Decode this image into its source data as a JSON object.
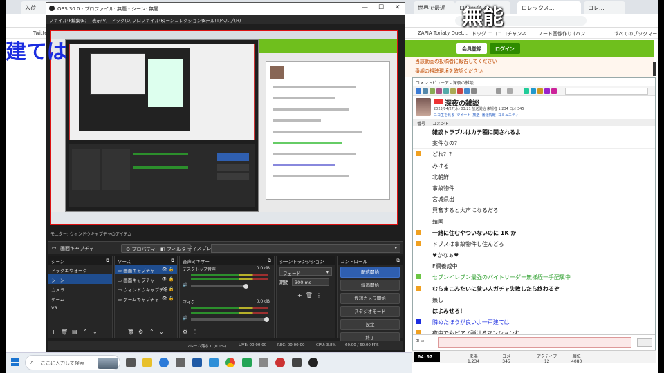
{
  "browser": {
    "tabs": [
      "入荷",
      "世界で最近",
      "ロレックス...",
      "ロレックス...",
      "ロレ..."
    ],
    "bookmarks": [
      "Twitter",
      "ZAPIA Toriaty Duet...",
      "ドッグ ニコニコチャンネ...",
      "ノード画像作り (ハン...",
      "すべてのブックマーク"
    ],
    "mu_overlay": "無能",
    "blue_overlay": "建ては",
    "nico_bar": {
      "btn_member": "会員登録",
      "btn_login": "ログイン"
    },
    "nico_lines": [
      "当該動画の投稿者に報告してください",
      "番組の視聴環境を確認ください"
    ]
  },
  "obs": {
    "title": "OBS 30.0 - プロファイル: 無題 - シーン: 無題",
    "menu": [
      "ファイル(F)",
      "編集(E)",
      "表示(V)",
      "ドック(D)",
      "プロファイル(P)",
      "シーンコレクション(S)",
      "ツール(T)",
      "ヘルプ(H)"
    ],
    "dock_label": "モニター: ウィンドウキャプチャのアイテム",
    "source_bar": {
      "selected": "画面キャプチャ",
      "properties": "プロパティ",
      "filters": "フィルタ",
      "display_label": "ディスプレイ"
    },
    "scenes_title": "シーン",
    "scenes": [
      "ドラクエウォーク",
      "シーン",
      "カメラ",
      "ゲーム",
      "VR"
    ],
    "sources_title": "ソース",
    "sources": [
      "画面キャプチャ",
      "画面キャプチャ",
      "ウィンドウキャプチャ",
      "ゲームキャプチャ"
    ],
    "mixer_title": "音声ミキサー",
    "mixer": [
      {
        "name": "デスクトップ音声",
        "db": "0.0 dB"
      },
      {
        "name": "マイク",
        "db": "0.0 dB"
      }
    ],
    "transitions_title": "シーントランジション",
    "transition_value": "フェード",
    "duration_label": "期間",
    "duration_value": "300 ms",
    "controls_title": "コントロール",
    "controls": [
      "配信開始",
      "録画開始",
      "仮想カメラ開始",
      "スタジオモード",
      "設定",
      "終了"
    ],
    "status": [
      "フレーム落ち 0 (0.0%)",
      "LIVE: 00:00:00",
      "REC: 00:00:00",
      "CPU: 3.8%",
      "60.00 / 60.00 FPS"
    ]
  },
  "viewer": {
    "title": "コメントビューア - 深夜の雑談",
    "stream_title": "深夜の雑談",
    "meta": "2023/04/27(木) 03:21 放送開始  来場者 1,234  コメ 345",
    "links": [
      "ニコ生を見る",
      "ツイート",
      "放送",
      "番組情報",
      "コミュニティ"
    ],
    "columns": [
      "番号",
      "コメント"
    ],
    "comments": [
      {
        "text": "雑談トラブルはカテ種に関されるよ",
        "mark": "",
        "color": "#111",
        "bold": true
      },
      {
        "text": "案件なの？",
        "mark": "",
        "color": "#222",
        "bold": false
      },
      {
        "text": "どれ？？",
        "mark": "#f0a020",
        "color": "#222",
        "bold": false
      },
      {
        "text": "みける",
        "mark": "",
        "color": "#222",
        "bold": false
      },
      {
        "text": "北朝鮮",
        "mark": "",
        "color": "#222",
        "bold": false
      },
      {
        "text": "事故物件",
        "mark": "",
        "color": "#222",
        "bold": false
      },
      {
        "text": "宮城県出",
        "mark": "",
        "color": "#222",
        "bold": false
      },
      {
        "text": "興奮すると大声になるだろ",
        "mark": "",
        "color": "#222",
        "bold": false
      },
      {
        "text": "韓国",
        "mark": "",
        "color": "#222",
        "bold": false
      },
      {
        "text": "一緒に住むやついないのに 1K か",
        "mark": "#f0a020",
        "color": "#111",
        "bold": true
      },
      {
        "text": "ドブスは事故物件し住んどろ",
        "mark": "#f0a020",
        "color": "#222",
        "bold": false
      },
      {
        "text": "♥かなぁ♥",
        "mark": "",
        "color": "#222",
        "bold": false
      },
      {
        "text": "F欄養成中",
        "mark": "",
        "color": "#222",
        "bold": false
      },
      {
        "text": "セブンイレブン最強のバイトリーダー無様経一手配属中",
        "mark": "#6cc644",
        "color": "#2fa02f",
        "bold": false
      },
      {
        "text": "むらまこみたいに狭い人ガチャ失敗したら終わるぞ",
        "mark": "#f0a020",
        "color": "#111",
        "bold": true
      },
      {
        "text": "無し",
        "mark": "",
        "color": "#222",
        "bold": false
      },
      {
        "text": "はよみせろ！",
        "mark": "",
        "color": "#111",
        "bold": true
      },
      {
        "text": "隣めたほうが良いよ一戸建ては",
        "mark": "#1b2de0",
        "color": "#1b2de0",
        "bold": false
      },
      {
        "text": "夜中でもピアノ弾けるマンションね",
        "mark": "#f0a020",
        "color": "#222",
        "bold": false
      }
    ],
    "time": "04:07",
    "stats": [
      {
        "label": "来場",
        "value": "1,234"
      },
      {
        "label": "コメ",
        "value": "345"
      },
      {
        "label": "アクティブ",
        "value": "12"
      },
      {
        "label": "順位",
        "value": "4080"
      }
    ]
  },
  "taskbar": {
    "search_placeholder": "ここに入力して検索"
  }
}
